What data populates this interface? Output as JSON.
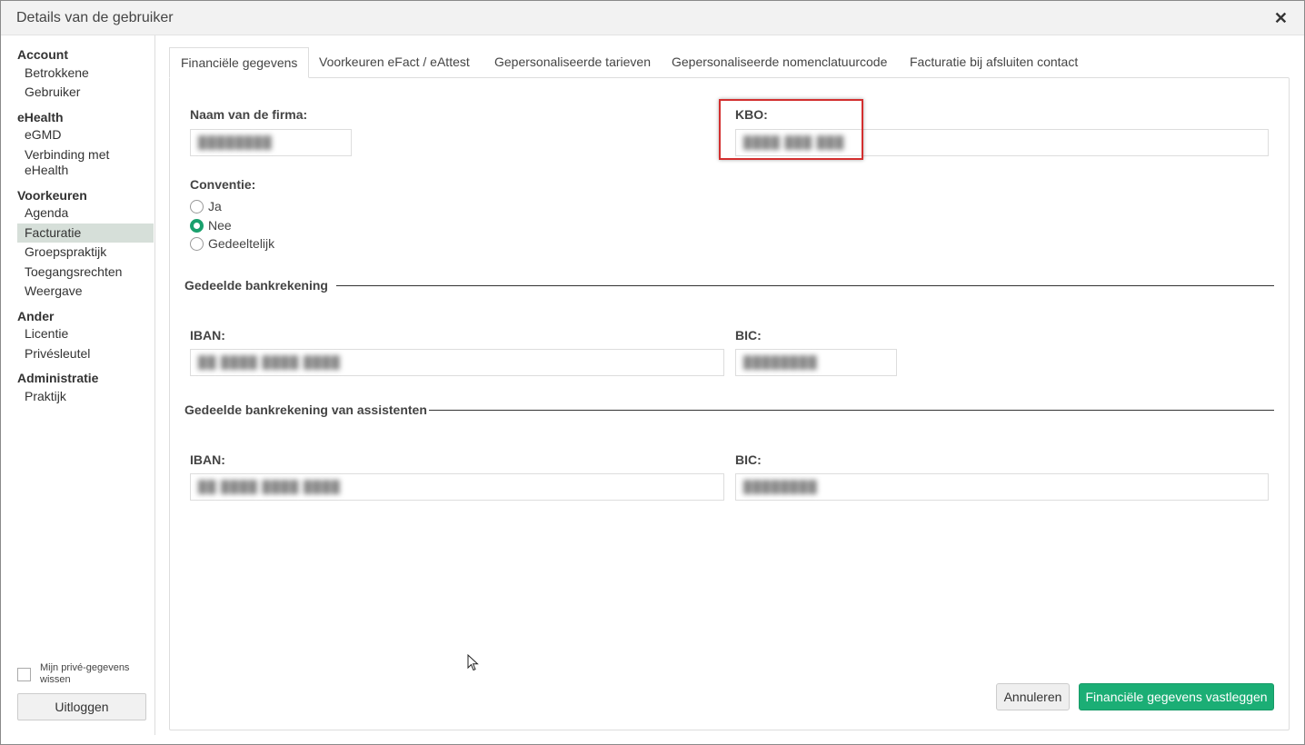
{
  "window": {
    "title": "Details van de gebruiker"
  },
  "sidebar": {
    "groups": [
      {
        "label": "Account",
        "items": [
          "Betrokkene",
          "Gebruiker"
        ]
      },
      {
        "label": "eHealth",
        "items": [
          "eGMD",
          "Verbinding met eHealth"
        ]
      },
      {
        "label": "Voorkeuren",
        "items": [
          "Agenda",
          "Facturatie",
          "Groepspraktijk",
          "Toegangsrechten",
          "Weergave"
        ]
      },
      {
        "label": "Ander",
        "items": [
          "Licentie",
          "Privésleutel"
        ]
      },
      {
        "label": "Administratie",
        "items": [
          "Praktijk"
        ]
      }
    ],
    "active_item": "Facturatie",
    "privacy_checkbox_label": "Mijn privé-gegevens wissen",
    "logout_label": "Uitloggen"
  },
  "tabs": [
    "Financiële gegevens",
    "Voorkeuren eFact / eAttest",
    "Gepersonaliseerde tarieven",
    "Gepersonaliseerde nomenclatuurcode",
    "Facturatie bij afsluiten contact"
  ],
  "active_tab": "Financiële gegevens",
  "form": {
    "firm_label": "Naam van de firma:",
    "firm_value": "████████",
    "kbo_label": "KBO:",
    "kbo_value": "████ ███ ███",
    "convention_label": "Conventie:",
    "convention_options": [
      "Ja",
      "Nee",
      "Gedeeltelijk"
    ],
    "convention_selected": "Nee",
    "shared_account_title": "Gedeelde bankrekening",
    "iban_label": "IBAN:",
    "bic_label": "BIC:",
    "shared_iban_value": "██ ████ ████ ████",
    "shared_bic_value": "████████",
    "assistants_account_title": "Gedeelde bankrekening van assistenten",
    "assistants_iban_value": "██ ████ ████ ████",
    "assistants_bic_value": "████████"
  },
  "buttons": {
    "cancel": "Annuleren",
    "save": "Financiële gegevens vastleggen"
  },
  "colors": {
    "accent": "#1bae75",
    "highlight": "#d32f2f",
    "active_sidebar": "#d6dfd9"
  }
}
